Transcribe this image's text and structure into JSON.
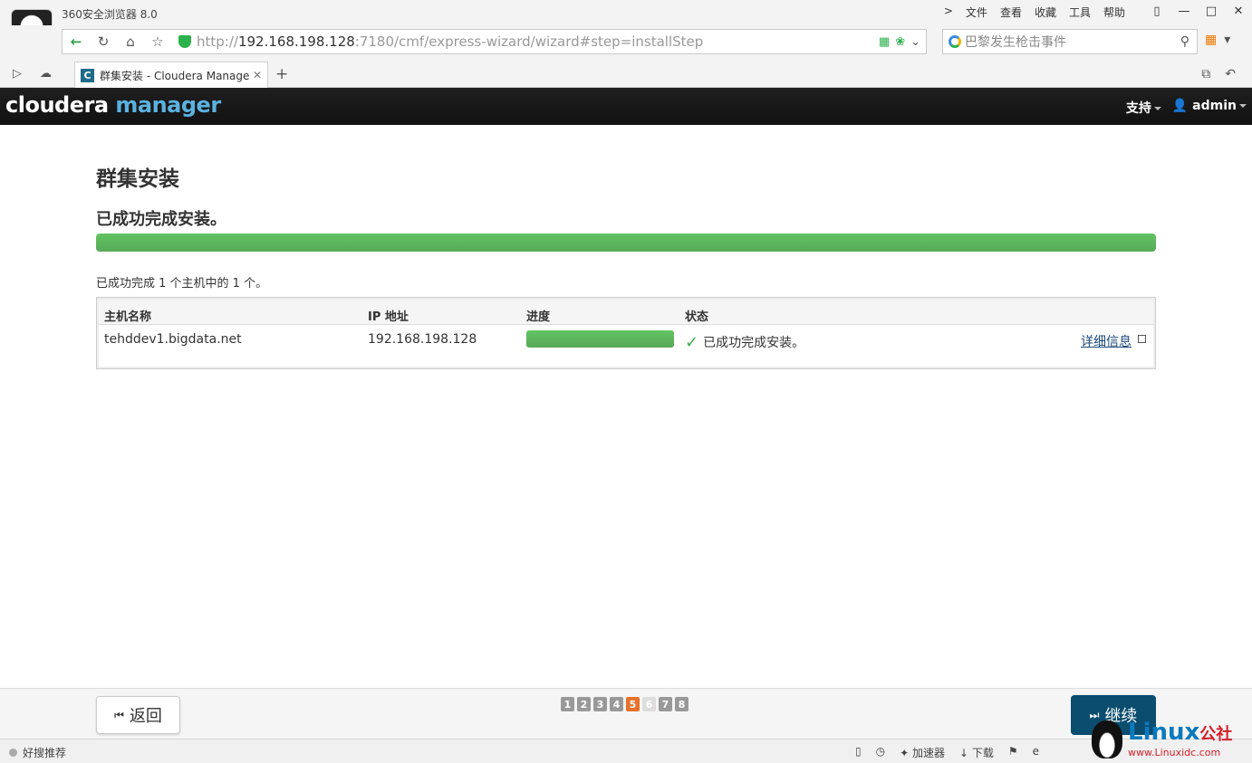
{
  "browser": {
    "app_title": "360安全浏览器 8.0",
    "menu": [
      "文件",
      "查看",
      "收藏",
      "工具",
      "帮助"
    ],
    "window_controls": [
      "shirt-icon",
      "minimize-icon",
      "maximize-icon",
      "close-icon"
    ],
    "url_scheme": "http://",
    "url_host": "192.168.198.128",
    "url_rest": ":7180/cmf/express-wizard/wizard#step=installStep",
    "search_placeholder": "巴黎发生枪击事件",
    "tab_title": "群集安装 - Cloudera Manage",
    "tab_favicon_letter": "C",
    "status_left": "好搜推荐",
    "status_right": [
      "加速器",
      "下载"
    ]
  },
  "cm": {
    "logo_cloudera": "cloudera",
    "logo_manager": "manager",
    "nav_support": "支持",
    "nav_user": "admin"
  },
  "page": {
    "title": "群集安装",
    "status_heading": "已成功完成安装。",
    "overall_progress": 1.0,
    "summary": "已成功完成 1 个主机中的 1 个。",
    "table": {
      "headers": [
        "主机名称",
        "IP 地址",
        "进度",
        "状态"
      ],
      "rows": [
        {
          "hostname": "tehddev1.bigdata.net",
          "ip": "192.168.198.128",
          "progress": 1.0,
          "status": "已成功完成安装。",
          "details_link": "详细信息"
        }
      ]
    }
  },
  "wizard": {
    "back_label": "返回",
    "continue_label": "继续",
    "steps": [
      "1",
      "2",
      "3",
      "4",
      "5",
      "6",
      "7",
      "8"
    ],
    "current_step": 5
  },
  "watermark": {
    "brand": "Linux",
    "suffix": "公社",
    "url": "www.Linuxidc.com"
  },
  "colors": {
    "progress_green": "#5cb85c",
    "header_bg": "#141414",
    "logo_accent": "#5bb1df",
    "continue_bg": "#0b4d6e",
    "current_step": "#e8702a"
  }
}
